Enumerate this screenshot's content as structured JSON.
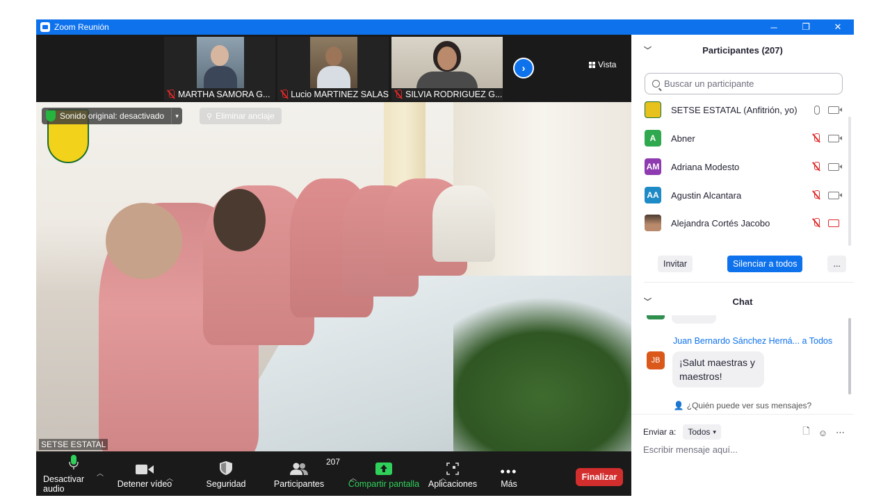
{
  "window": {
    "title": "Zoom Reunión",
    "controls": [
      "─",
      "❐",
      "✕"
    ]
  },
  "thumbnails": [
    {
      "name": "MARTHA SAMORA G...",
      "bg": "#6f7f8c"
    },
    {
      "name": "Lucio MARTINEZ SALAS",
      "bg": "#7c6a55"
    },
    {
      "name": "SILVIA RODRIGUEZ G...",
      "bg": "#c9c3b5"
    }
  ],
  "view": {
    "label": "Vista"
  },
  "overlay": {
    "audio_label": "Sonido original: desactivado",
    "dropdown_glyph": "▾",
    "unpin_label": "Eliminar anclaje",
    "speaker_name": "SETSE ESTATAL"
  },
  "toolbar": {
    "audio": "Desactivar audio",
    "video": "Detener vídeo",
    "security": "Seguridad",
    "participants": "Participantes",
    "participants_count": "207",
    "share": "Compartir pantalla",
    "apps": "Aplicaciones",
    "more": "Más",
    "end": "Finalizar"
  },
  "panel": {
    "participants_title": "Participantes (207)",
    "search_placeholder": "Buscar un participante",
    "participants": [
      {
        "name": "SETSE ESTATAL (Anfitrión, yo)",
        "initials": "",
        "color": "#e8c21c",
        "mic": "on",
        "cam": "on"
      },
      {
        "name": "Abner",
        "initials": "A",
        "color": "#2fa84f",
        "mic": "off",
        "cam": "on"
      },
      {
        "name": "Adriana Modesto",
        "initials": "AM",
        "color": "#8e3ab0",
        "mic": "off",
        "cam": "on"
      },
      {
        "name": "Agustin Alcantara",
        "initials": "AA",
        "color": "#1e8ac6",
        "mic": "off",
        "cam": "on"
      },
      {
        "name": "Alejandra Cortés Jacobo",
        "initials": "",
        "color": "#8a6a56",
        "mic": "off",
        "cam": "off"
      }
    ],
    "invite": "Invitar",
    "mute_all": "Silenciar a todos",
    "more": "...",
    "chat_title": "Chat",
    "chat": {
      "sender": "Juan Bernardo Sánchez Herná...",
      "to": "a Todos",
      "initials": "JB",
      "message": "¡Salut maestras y maestros!"
    },
    "who_can_see": "¿Quién puede ver sus mensajes?",
    "send_to_label": "Enviar a:",
    "send_to_value": "Todos",
    "compose_placeholder": "Escribir mensaje aquí..."
  }
}
